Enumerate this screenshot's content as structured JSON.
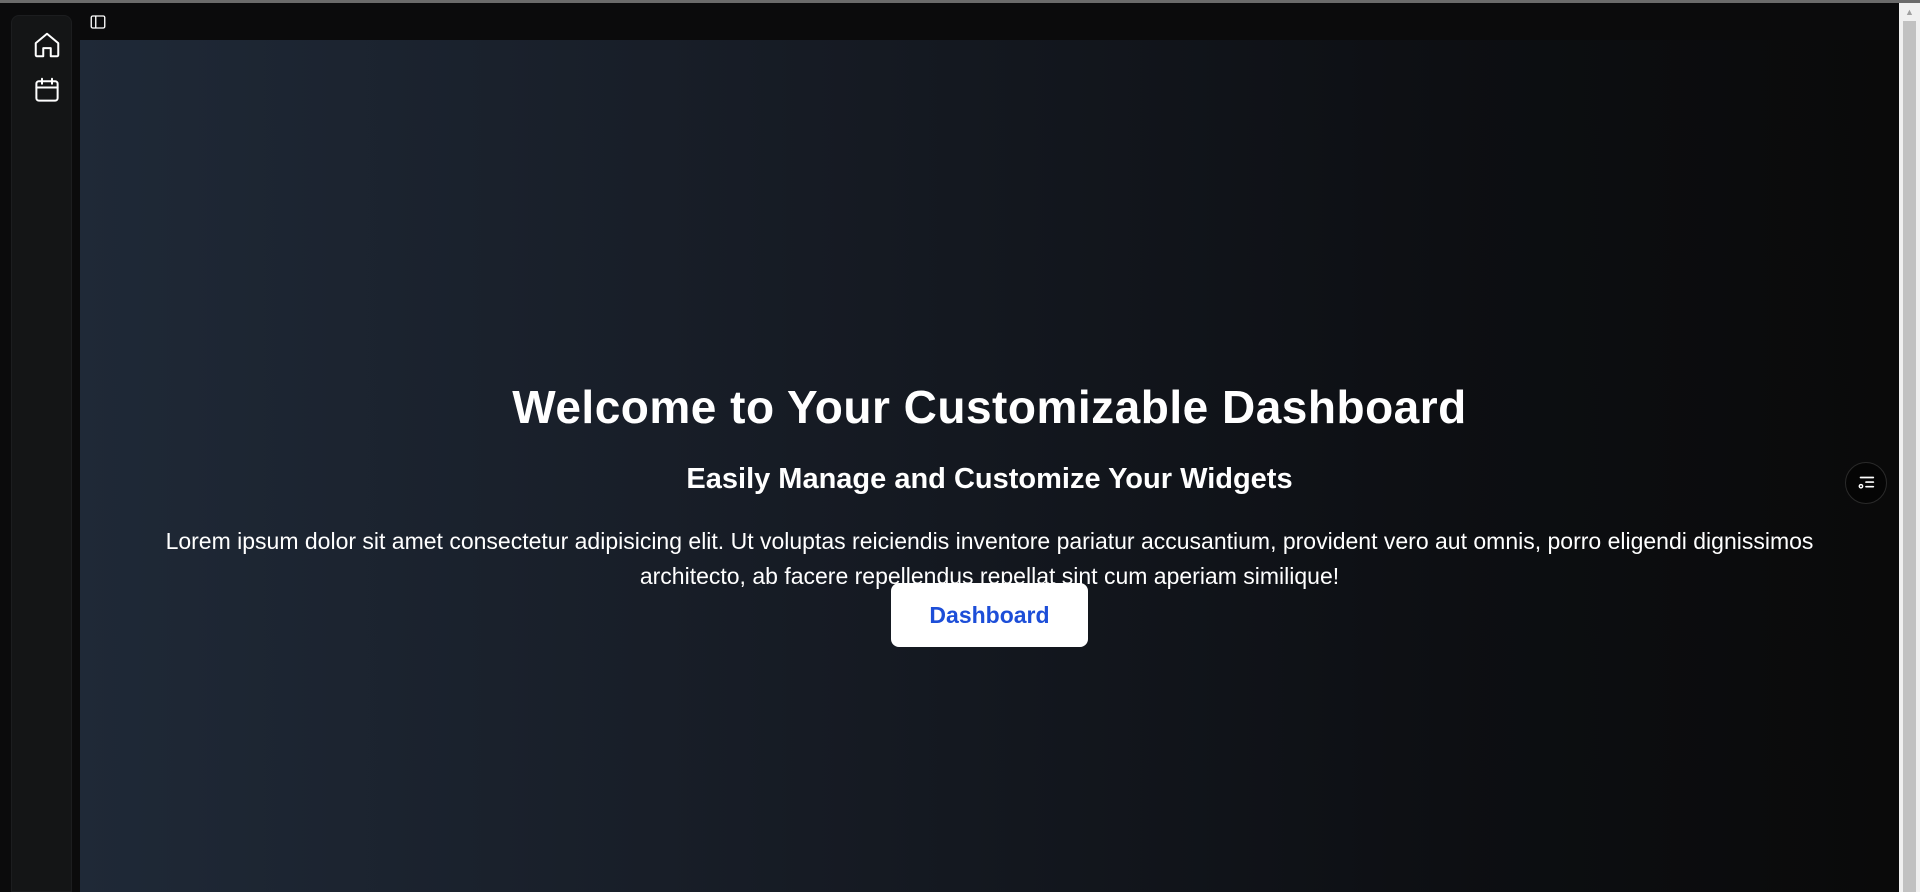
{
  "sidebar": {
    "items": [
      {
        "icon": "home-icon",
        "label": "Home"
      },
      {
        "icon": "calendar-icon",
        "label": "Calendar"
      }
    ]
  },
  "toolbar": {
    "toggle_icon": "sidebar-toggle-icon"
  },
  "hero": {
    "title": "Welcome to Your Customizable Dashboard",
    "subtitle": "Easily Manage and Customize Your Widgets",
    "body": "Lorem ipsum dolor sit amet consectetur adipisicing elit. Ut voluptas reiciendis inventore pariatur accusantium, provident vero aut omnis, porro eligendi dignissimos architecto, ab facere repellendus repellat sint cum aperiam similique!",
    "button_label": "Dashboard"
  },
  "widget_button": {
    "icon": "widget-settings-icon"
  },
  "colors": {
    "background_start": "#1f2937",
    "background_end": "#0a0a0a",
    "button_bg": "#ffffff",
    "button_text": "#1d4ed8",
    "text": "#ffffff"
  }
}
